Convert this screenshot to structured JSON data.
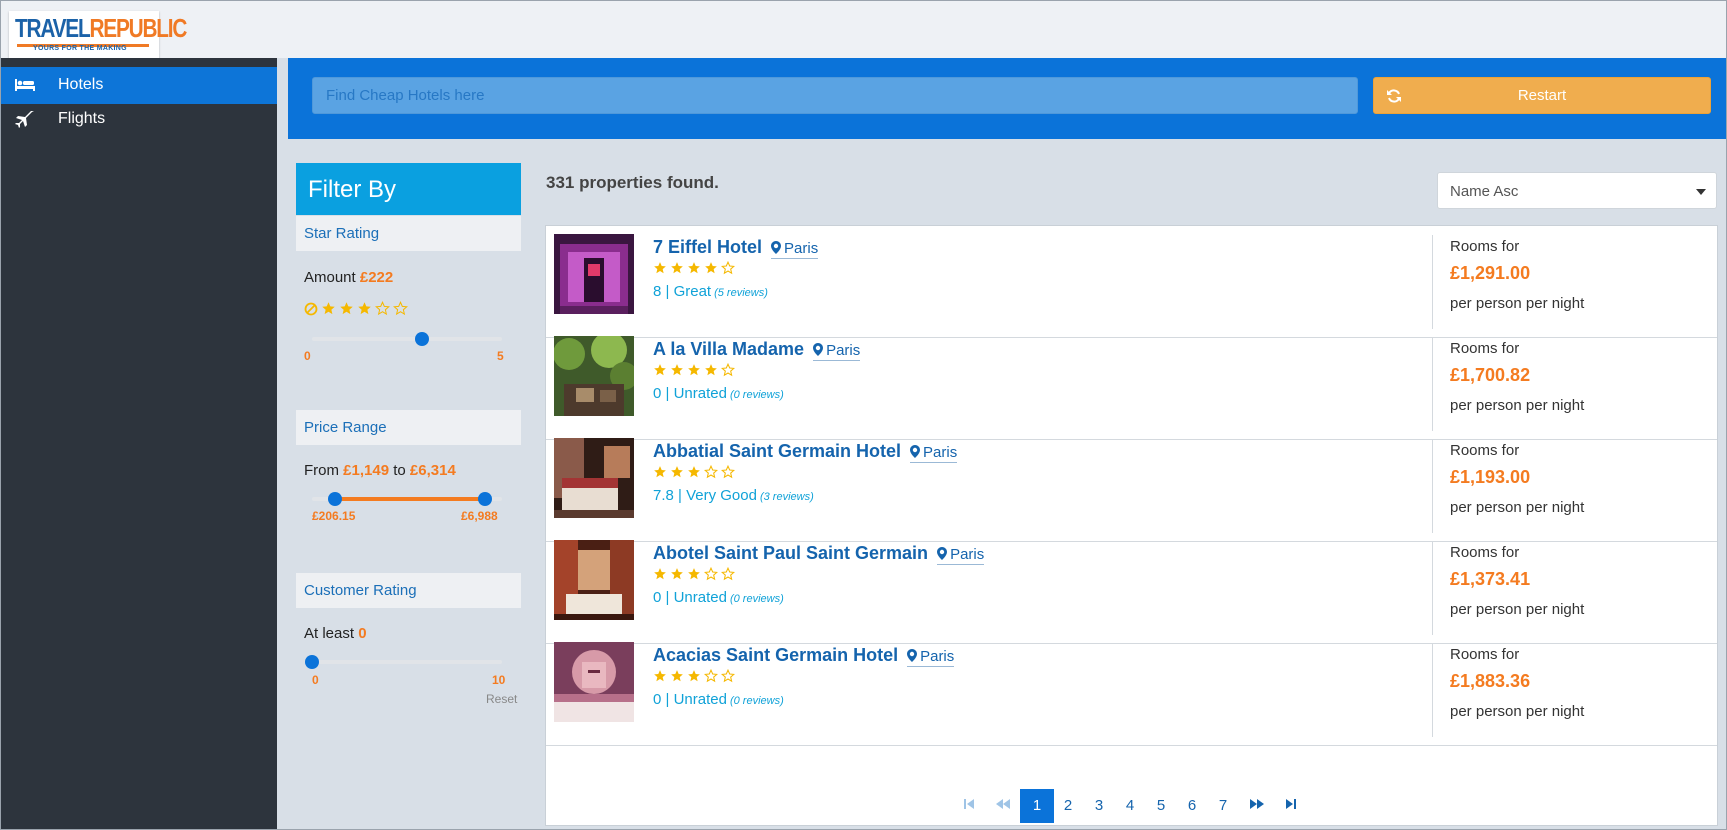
{
  "brand": {
    "line1a": "TRAVEL",
    "line1b": "REPUBLIC",
    "tagline": "YOURS FOR THE MAKING"
  },
  "sidebar": {
    "items": [
      {
        "label": "Hotels",
        "icon": "bed-icon",
        "active": true
      },
      {
        "label": "Flights",
        "icon": "plane-icon",
        "active": false
      }
    ]
  },
  "search": {
    "placeholder": "Find Cheap Hotels here",
    "value": ""
  },
  "restart_label": "Restart",
  "filter": {
    "title": "Filter By",
    "star": {
      "heading": "Star Rating",
      "amount_label": "Amount",
      "amount_value": "£222",
      "min": "0",
      "max": "5",
      "value": 3
    },
    "price": {
      "heading": "Price Range",
      "from_label": "From",
      "from_value": "£1,149",
      "to_label": "to",
      "to_value": "£6,314",
      "min": "£206.15",
      "max": "£6,988"
    },
    "customer": {
      "heading": "Customer Rating",
      "label": "At least",
      "value": "0",
      "min": "0",
      "max": "10",
      "reset": "Reset"
    }
  },
  "results": {
    "count_text": "331 properties found.",
    "sort": "Name Asc",
    "hotels": [
      {
        "name": "7 Eiffel Hotel",
        "city": "Paris",
        "stars": 4,
        "score": "8 | Great",
        "reviews": "(5 reviews)",
        "rooms_for": "Rooms for",
        "price": "£1,291.00",
        "per": "per person per night",
        "img": "purple"
      },
      {
        "name": "A la Villa Madame",
        "city": "Paris",
        "stars": 4,
        "score": "0 | Unrated",
        "reviews": "(0 reviews)",
        "rooms_for": "Rooms for",
        "price": "£1,700.82",
        "per": "per person per night",
        "img": "garden"
      },
      {
        "name": "Abbatial Saint Germain Hotel",
        "city": "Paris",
        "stars": 3,
        "score": "7.8 | Very Good",
        "reviews": "(3 reviews)",
        "rooms_for": "Rooms for",
        "price": "£1,193.00",
        "per": "per person per night",
        "img": "room"
      },
      {
        "name": "Abotel Saint Paul Saint Germain",
        "city": "Paris",
        "stars": 3,
        "score": "0 | Unrated",
        "reviews": "(0 reviews)",
        "rooms_for": "Rooms for",
        "price": "£1,373.41",
        "per": "per person per night",
        "img": "red"
      },
      {
        "name": "Acacias Saint Germain Hotel",
        "city": "Paris",
        "stars": 3,
        "score": "0 | Unrated",
        "reviews": "(0 reviews)",
        "rooms_for": "Rooms for",
        "price": "£1,883.36",
        "per": "per person per night",
        "img": "pink"
      }
    ]
  },
  "pagination": {
    "pages": [
      "1",
      "2",
      "3",
      "4",
      "5",
      "6",
      "7"
    ],
    "current": "1"
  },
  "colors": {
    "accent": "#0b73d9",
    "orange": "#f47b20",
    "restart": "#f0ad4e",
    "star": "#f5b800",
    "sidebar": "#2d343d"
  }
}
